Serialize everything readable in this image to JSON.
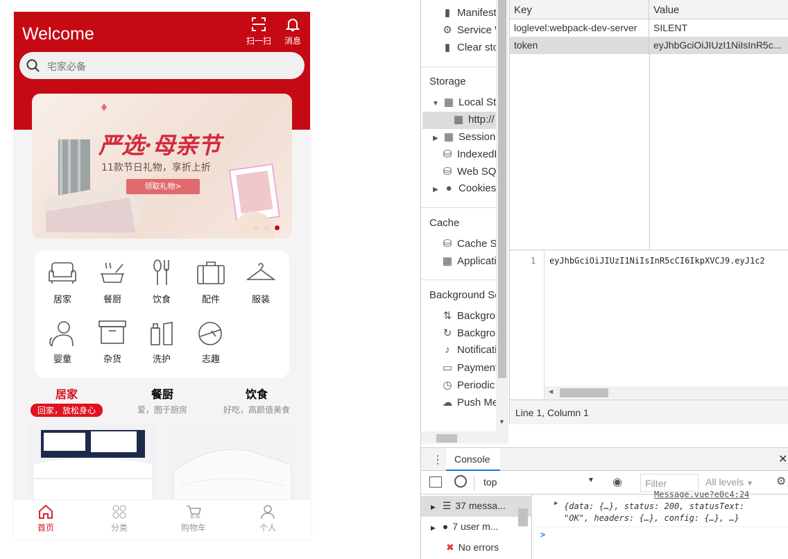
{
  "app": {
    "welcome": "Welcome",
    "scan_label": "扫一扫",
    "msg_label": "消息",
    "search_placeholder": "宅家必备",
    "banner": {
      "title": "严选·母亲节",
      "subtitle": "11款节日礼物，享折上折",
      "button": "领取礼物>"
    },
    "categories": [
      "居家",
      "餐厨",
      "饮食",
      "配件",
      "服装",
      "婴童",
      "杂货",
      "洗护",
      "志趣"
    ],
    "tabs": [
      {
        "title": "居家",
        "sub": "回家，放松身心"
      },
      {
        "title": "餐厨",
        "sub": "爱，囿于厨房"
      },
      {
        "title": "饮食",
        "sub": "好吃，高颜值美食"
      }
    ],
    "tabbar": [
      "首页",
      "分类",
      "购物车",
      "个人"
    ],
    "colors": {
      "brand": "#c50a14",
      "accent": "#e01220"
    }
  },
  "devtools": {
    "sidebar": {
      "app_items": [
        "Manifest",
        "Service Workers",
        "Clear storage"
      ],
      "storage_head": "Storage",
      "storage_items": [
        "Local Storage",
        "http://",
        "Session Storage",
        "IndexedDB",
        "Web SQL",
        "Cookies"
      ],
      "cache_head": "Cache",
      "cache_items": [
        "Cache Storage",
        "Application Cache"
      ],
      "bg_head": "Background Services",
      "bg_items": [
        "Background Fetch",
        "Background Sync",
        "Notifications",
        "Payment Handler",
        "Periodic Background Sync",
        "Push Messaging"
      ]
    },
    "table": {
      "col_key": "Key",
      "col_value": "Value",
      "rows": [
        {
          "key": "loglevel:webpack-dev-server",
          "value": "SILENT"
        },
        {
          "key": "token",
          "value": "eyJhbGciOiJIUzI1NiIsInR5c..."
        }
      ]
    },
    "editor": {
      "line_no": "1",
      "content": "eyJhbGciOiJIUzI1NiIsInR5cCI6IkpXVCJ9.eyJ1c2"
    },
    "status": "Line 1, Column 1",
    "console": {
      "tab": "Console",
      "context": "top",
      "filter_placeholder": "Filter",
      "levels": "All levels",
      "side": [
        "37 messa...",
        "7 user m...",
        "No errors"
      ],
      "source": "Message.vue?e0c4:24",
      "log_line1": "{data: {…}, status: 200, statusText:",
      "log_line2": "\"OK\", headers: {…}, config: {…}, …}",
      "prompt": ">"
    }
  }
}
